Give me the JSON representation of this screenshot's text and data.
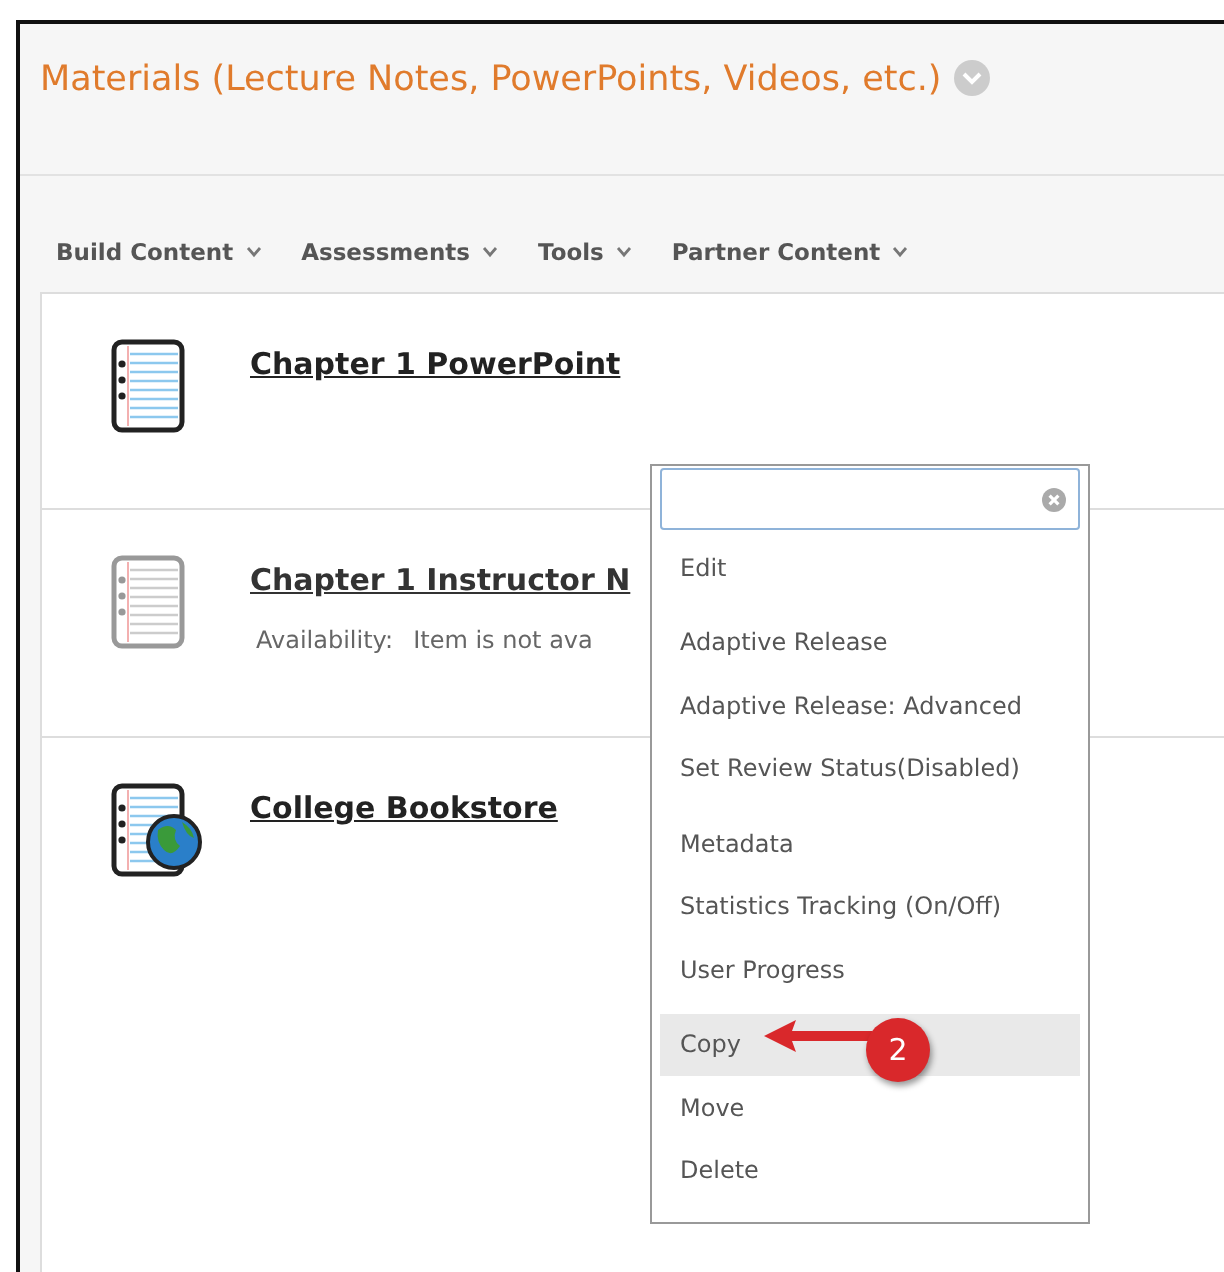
{
  "page_title": "Materials (Lecture Notes, PowerPoints, Videos, etc.)",
  "toolbar": [
    {
      "label": "Build Content"
    },
    {
      "label": "Assessments"
    },
    {
      "label": "Tools"
    },
    {
      "label": "Partner Content"
    }
  ],
  "items": [
    {
      "kind": "document",
      "title": "Chapter 1 PowerPoint",
      "disabled": false
    },
    {
      "kind": "document",
      "title": "Chapter 1 Instructor N",
      "disabled": true,
      "availability_label": "Availability:",
      "availability": "Item is not ava"
    },
    {
      "kind": "link",
      "title": "College Bookstore",
      "disabled": false
    }
  ],
  "context_menu": {
    "groups": [
      [
        {
          "label": "Edit",
          "selected": false
        }
      ],
      [
        {
          "label": "Adaptive Release",
          "selected": false
        },
        {
          "label": "Adaptive Release: Advanced",
          "selected": false
        },
        {
          "label": "Set Review Status(Disabled)",
          "selected": false
        }
      ],
      [
        {
          "label": "Metadata",
          "selected": false
        },
        {
          "label": "Statistics Tracking (On/Off)",
          "selected": false
        },
        {
          "label": "User Progress",
          "selected": false
        }
      ],
      [
        {
          "label": "Copy",
          "selected": true
        },
        {
          "label": "Move",
          "selected": false
        },
        {
          "label": "Delete",
          "selected": false
        }
      ]
    ]
  },
  "callout": {
    "number": "2"
  }
}
